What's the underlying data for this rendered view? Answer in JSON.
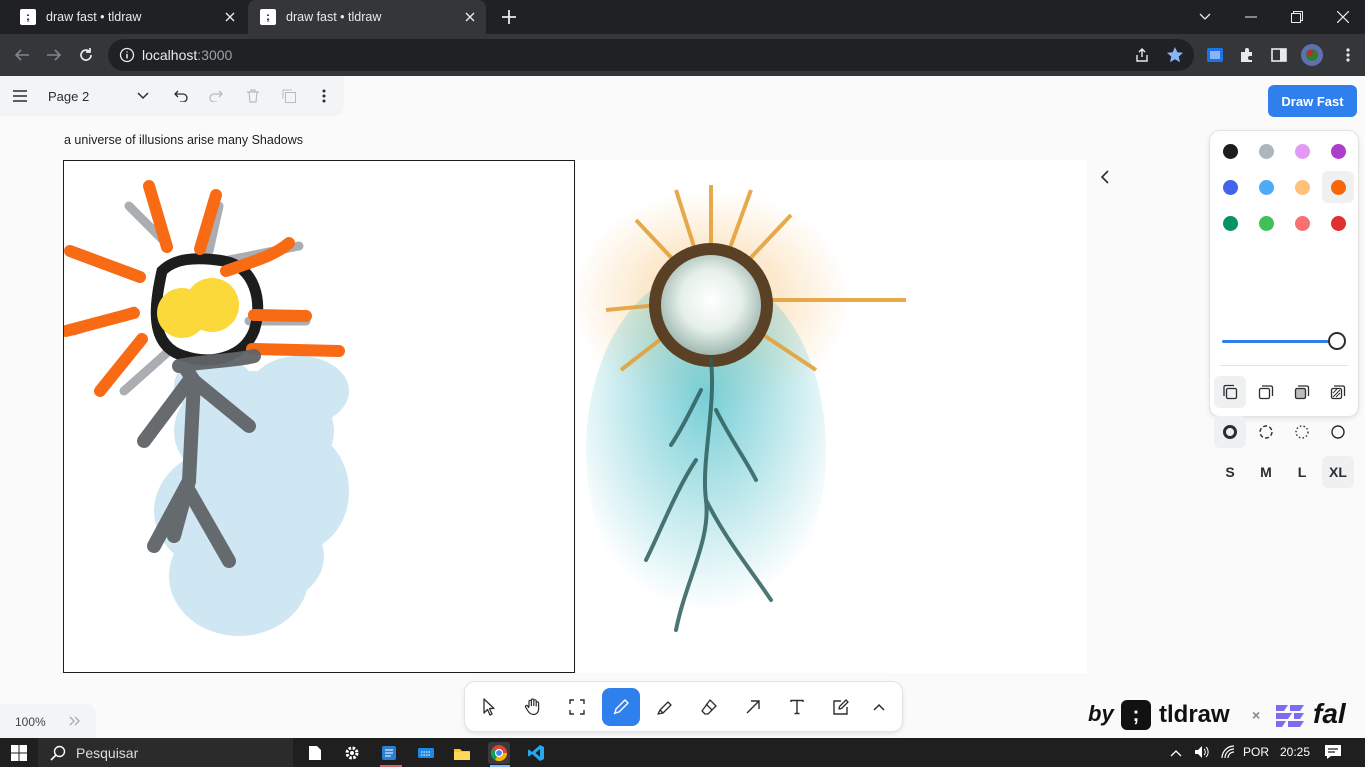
{
  "browser": {
    "tabs": [
      {
        "title": "draw fast • tldraw",
        "active": false
      },
      {
        "title": "draw fast • tldraw",
        "active": true
      }
    ],
    "url_host": "localhost",
    "url_port": ":3000"
  },
  "app": {
    "page_name": "Page 2",
    "primary_button": "Draw Fast",
    "prompt": "a universe of illusions arise many Shadows",
    "zoom": "100%",
    "colors": [
      "#1d1d1d",
      "#adb5bd",
      "#e599f7",
      "#ae3ec9",
      "#4263eb",
      "#4dabf7",
      "#ffc078",
      "#f76707",
      "#099268",
      "#40c057",
      "#f87171",
      "#e03131"
    ],
    "selected_color": "#f76707",
    "opacity": 1.0,
    "sizes": [
      "S",
      "M",
      "L",
      "XL"
    ],
    "selected_size": "XL",
    "tools": [
      "select",
      "hand",
      "frame",
      "draw",
      "highlight",
      "eraser",
      "arrow",
      "text",
      "note",
      "more"
    ],
    "selected_tool": "draw"
  },
  "brand": {
    "by": "by",
    "name": "tldraw",
    "times": "×",
    "partner": "fal"
  },
  "taskbar": {
    "search": "Pesquisar",
    "lang": "POR",
    "time": "20:25"
  }
}
